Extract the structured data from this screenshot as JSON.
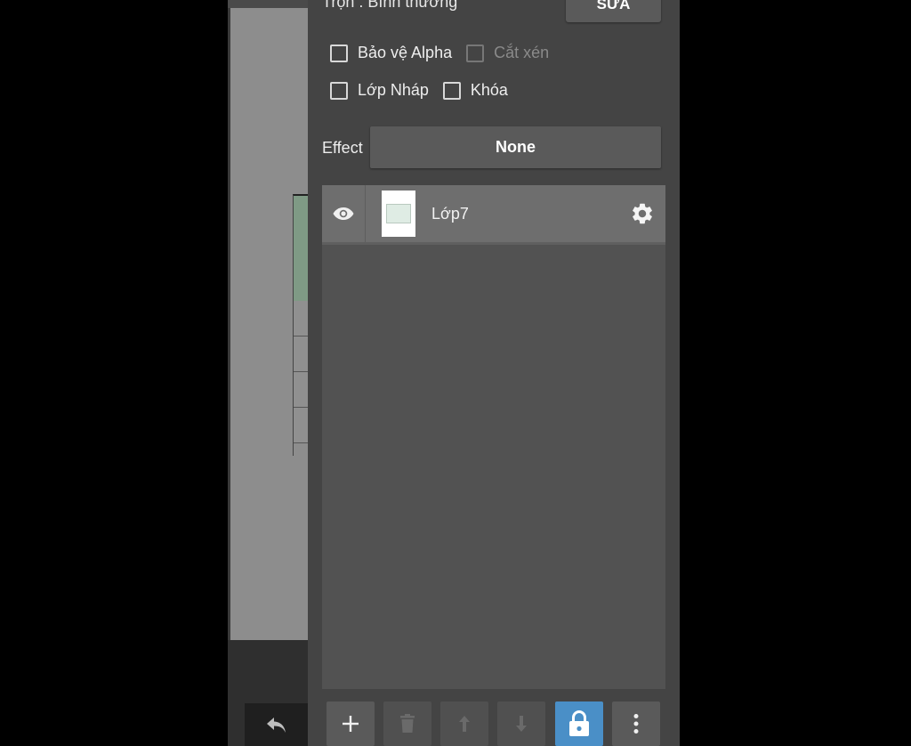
{
  "panel": {
    "blend_label": "Trộn : Bình thường",
    "edit_button": "SỬA",
    "checkboxes": {
      "protect_alpha": "Bảo vệ Alpha",
      "clipping": "Cắt xén",
      "draft_layer": "Lớp Nháp",
      "lock": "Khóa"
    },
    "effect_label": "Effect",
    "effect_value": "None"
  },
  "layers": [
    {
      "name": "Lớp7",
      "visible": true
    }
  ],
  "colors": {
    "panel_bg": "#444444",
    "list_bg": "#525252",
    "row_bg": "#6e6e6e",
    "lock_active": "#4a8fc7"
  },
  "icons": {
    "visibility": "eye-icon",
    "settings": "gear-icon",
    "undo": "undo-icon",
    "add": "plus-icon",
    "delete": "trash-icon",
    "move_up": "arrow-up-icon",
    "move_down": "arrow-down-icon",
    "lock": "lock-icon",
    "more": "more-vertical-icon"
  }
}
